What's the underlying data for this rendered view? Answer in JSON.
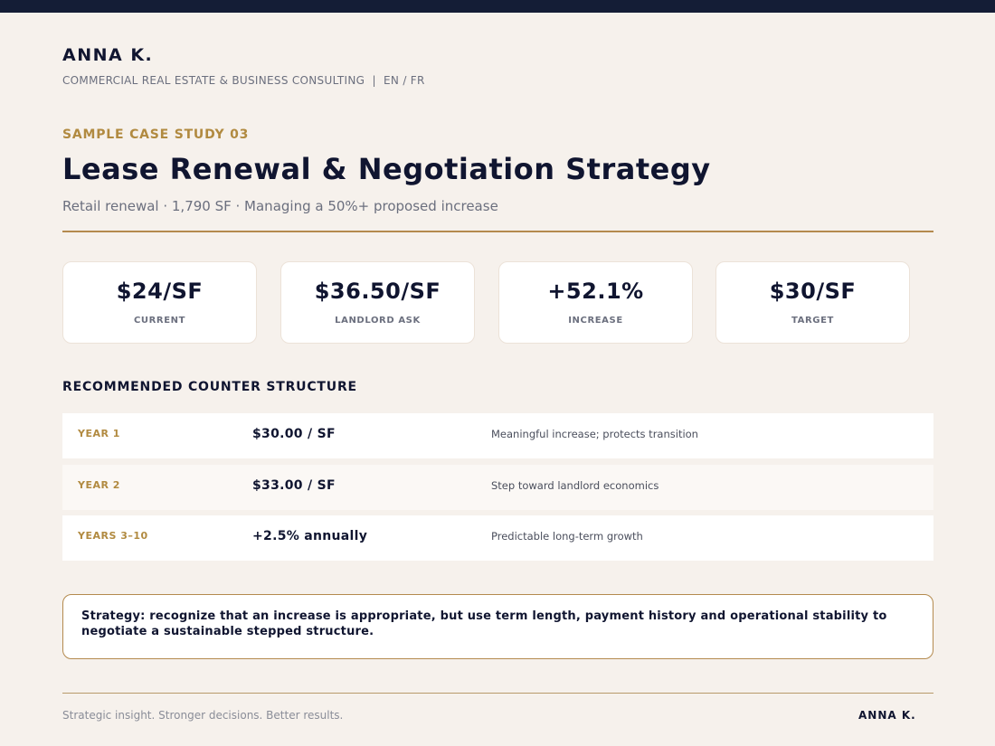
{
  "header": {
    "brand": "ANNA K.",
    "tagline": "COMMERCIAL REAL ESTATE & BUSINESS CONSULTING  |  EN / FR"
  },
  "case": {
    "eyebrow": "SAMPLE CASE STUDY 03",
    "title": "Lease Renewal & Negotiation Strategy",
    "subtitle": "Retail renewal · 1,790 SF · Managing a 50%+ proposed increase"
  },
  "stats": [
    {
      "value": "$24/SF",
      "label": "CURRENT"
    },
    {
      "value": "$36.50/SF",
      "label": "LANDLORD ASK"
    },
    {
      "value": "+52.1%",
      "label": "INCREASE"
    },
    {
      "value": "$30/SF",
      "label": "TARGET"
    }
  ],
  "counter": {
    "heading": "RECOMMENDED COUNTER STRUCTURE",
    "rows": [
      {
        "period": "YEAR 1",
        "rate": "$30.00 / SF",
        "note": "Meaningful increase; protects transition"
      },
      {
        "period": "YEAR 2",
        "rate": "$33.00 / SF",
        "note": "Step toward landlord economics"
      },
      {
        "period": "YEARS 3–10",
        "rate": "+2.5% annually",
        "note": "Predictable long-term growth"
      }
    ]
  },
  "strategy": "Strategy: recognize that an increase is appropriate, but use term length, payment history and operational stability to negotiate a sustainable stepped structure.",
  "footer": {
    "slogan": "Strategic insight. Stronger decisions. Better results.",
    "brand": "ANNA K."
  }
}
